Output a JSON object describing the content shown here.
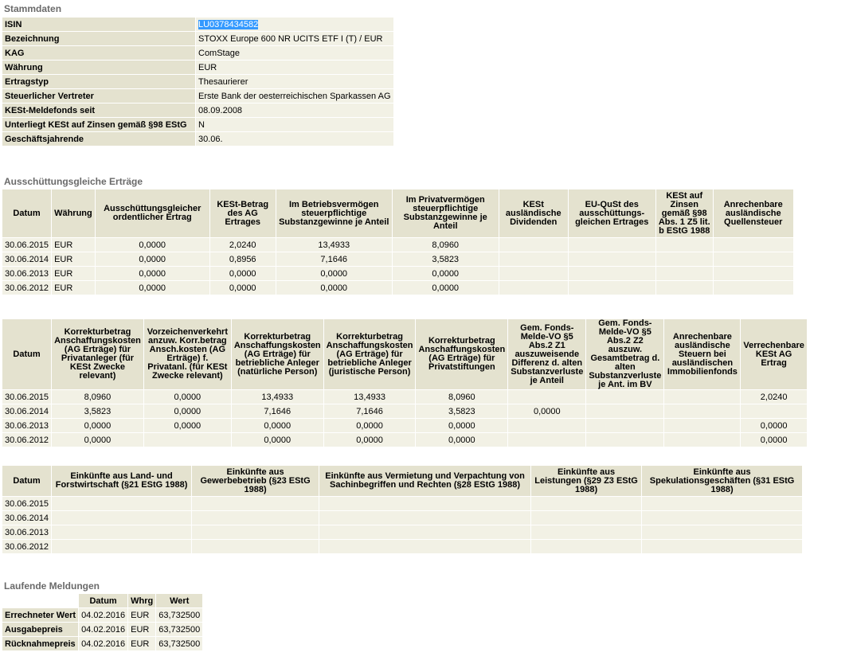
{
  "stammdaten": {
    "title": "Stammdaten",
    "rows": [
      {
        "label": "ISIN",
        "value": "LU0378434582"
      },
      {
        "label": "Bezeichnung",
        "value": "STOXX Europe 600 NR UCITS ETF I (T) / EUR"
      },
      {
        "label": "KAG",
        "value": "ComStage"
      },
      {
        "label": "Währung",
        "value": "EUR"
      },
      {
        "label": "Ertragstyp",
        "value": "Thesaurierer"
      },
      {
        "label": "Steuerlicher Vertreter",
        "value": "Erste Bank der oesterreichischen Sparkassen AG"
      },
      {
        "label": "KESt-Meldefonds seit",
        "value": "08.09.2008"
      },
      {
        "label": "Unterliegt KESt auf Zinsen gemäß §98 EStG",
        "value": "N"
      },
      {
        "label": "Geschäftsjahrende",
        "value": "30.06."
      }
    ]
  },
  "ausschuettung": {
    "title": "Ausschüttungsgleiche Erträge",
    "table1": {
      "headers": [
        "Datum",
        "Währung",
        "Ausschüttungsgleicher ordentlicher Ertrag",
        "KESt-Betrag des AG Ertrages",
        "Im Betriebsvermögen steuerpflichtige Substanzgewinne je Anteil",
        "Im Privatvermögen steuerpflichtige Substanzgewinne je Anteil",
        "KESt ausländische Dividenden",
        "EU-QuSt des ausschüttungs-gleichen Ertrages",
        "KESt auf Zinsen gemäß §98 Abs. 1 Z5 lit. b EStG 1988",
        "Anrechenbare ausländische Quellensteuer"
      ],
      "rows": [
        [
          "30.06.2015",
          "EUR",
          "0,0000",
          "2,0240",
          "13,4933",
          "8,0960",
          "",
          "",
          "",
          ""
        ],
        [
          "30.06.2014",
          "EUR",
          "0,0000",
          "0,8956",
          "7,1646",
          "3,5823",
          "",
          "",
          "",
          ""
        ],
        [
          "30.06.2013",
          "EUR",
          "0,0000",
          "0,0000",
          "0,0000",
          "0,0000",
          "",
          "",
          "",
          ""
        ],
        [
          "30.06.2012",
          "EUR",
          "0,0000",
          "0,0000",
          "0,0000",
          "0,0000",
          "",
          "",
          "",
          ""
        ]
      ]
    },
    "table2": {
      "headers": [
        "Datum",
        "Korrekturbetrag Anschaffungskosten (AG Erträge) für Privatanleger (für KESt Zwecke relevant)",
        "Vorzeichenverkehrt anzuw. Korr.betrag Ansch.kosten (AG Erträge) f. Privatanl. (für KESt Zwecke relevant)",
        "Korrekturbetrag Anschaffungskosten (AG Erträge) für betriebliche Anleger (natürliche Person)",
        "Korrekturbetrag Anschaffungskosten (AG Erträge) für betriebliche Anleger (juristische Person)",
        "Korrekturbetrag Anschaffungskosten (AG Erträge) für Privatstiftungen",
        "Gem. Fonds-Melde-VO §5 Abs.2 Z1 auszuweisende Differenz d. alten Substanzverluste je Anteil",
        "Gem. Fonds-Melde-VO §5 Abs.2 Z2 auszuw. Gesamtbetrag d. alten Substanzverluste je Ant. im BV",
        "Anrechenbare ausländische Steuern bei ausländischen Immobilienfonds",
        "Verrechenbare KESt AG Ertrag"
      ],
      "rows": [
        [
          "30.06.2015",
          "8,0960",
          "0,0000",
          "13,4933",
          "13,4933",
          "8,0960",
          "",
          "",
          "",
          "2,0240"
        ],
        [
          "30.06.2014",
          "3,5823",
          "0,0000",
          "7,1646",
          "7,1646",
          "3,5823",
          "0,0000",
          "",
          "",
          ""
        ],
        [
          "30.06.2013",
          "0,0000",
          "0,0000",
          "0,0000",
          "0,0000",
          "0,0000",
          "",
          "",
          "",
          "0,0000"
        ],
        [
          "30.06.2012",
          "0,0000",
          "",
          "0,0000",
          "0,0000",
          "0,0000",
          "",
          "",
          "",
          "0,0000"
        ]
      ]
    },
    "table3": {
      "headers": [
        "Datum",
        "Einkünfte aus Land- und Forstwirtschaft (§21 EStG 1988)",
        "Einkünfte aus Gewerbebetrieb (§23 EStG 1988)",
        "Einkünfte aus Vermietung und Verpachtung von Sachinbegriffen und Rechten (§28 EStG 1988)",
        "Einkünfte aus Leistungen (§29 Z3 EStG 1988)",
        "Einkünfte aus Spekulationsgeschäften (§31 EStG 1988)"
      ],
      "rows": [
        [
          "30.06.2015",
          "",
          "",
          "",
          "",
          ""
        ],
        [
          "30.06.2014",
          "",
          "",
          "",
          "",
          ""
        ],
        [
          "30.06.2013",
          "",
          "",
          "",
          "",
          ""
        ],
        [
          "30.06.2012",
          "",
          "",
          "",
          "",
          ""
        ]
      ]
    }
  },
  "laufende": {
    "title": "Laufende Meldungen",
    "headers": [
      "",
      "Datum",
      "Whrg",
      "Wert"
    ],
    "rows": [
      [
        "Errechneter Wert",
        "04.02.2016",
        "EUR",
        "63,732500"
      ],
      [
        "Ausgabepreis",
        "04.02.2016",
        "EUR",
        "63,732500"
      ],
      [
        "Rücknahmepreis",
        "04.02.2016",
        "EUR",
        "63,732500"
      ]
    ]
  }
}
